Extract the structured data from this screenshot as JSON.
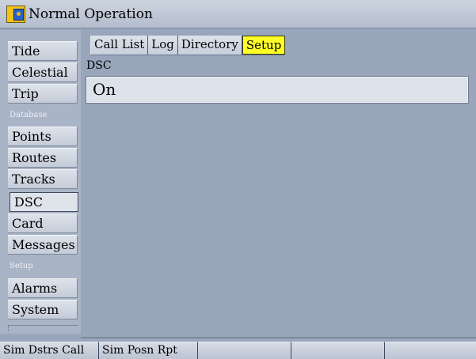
{
  "titlebar": {
    "title": "Normal Operation",
    "icon": "map-book-icon"
  },
  "sidebar": {
    "items": [
      {
        "label": "Tide"
      },
      {
        "label": "Celestial"
      },
      {
        "label": "Trip"
      },
      {
        "label": "Points"
      },
      {
        "label": "Routes"
      },
      {
        "label": "Tracks"
      },
      {
        "label": "DSC",
        "selected": true
      },
      {
        "label": "Card"
      },
      {
        "label": "Messages"
      },
      {
        "label": "Alarms"
      },
      {
        "label": "System"
      }
    ],
    "headers": {
      "database": "Database",
      "setup": "Setup"
    }
  },
  "tabs": [
    {
      "label": "Call List"
    },
    {
      "label": "Log"
    },
    {
      "label": "Directory"
    },
    {
      "label": "Setup",
      "active": true
    }
  ],
  "content": {
    "section_label": "DSC",
    "field_value": "On"
  },
  "softkeys": [
    "Sim Dstrs Call",
    "Sim Posn Rpt",
    "",
    "",
    ""
  ],
  "colors": {
    "active_tab": "#ffff26",
    "background": "#98a5bb"
  }
}
